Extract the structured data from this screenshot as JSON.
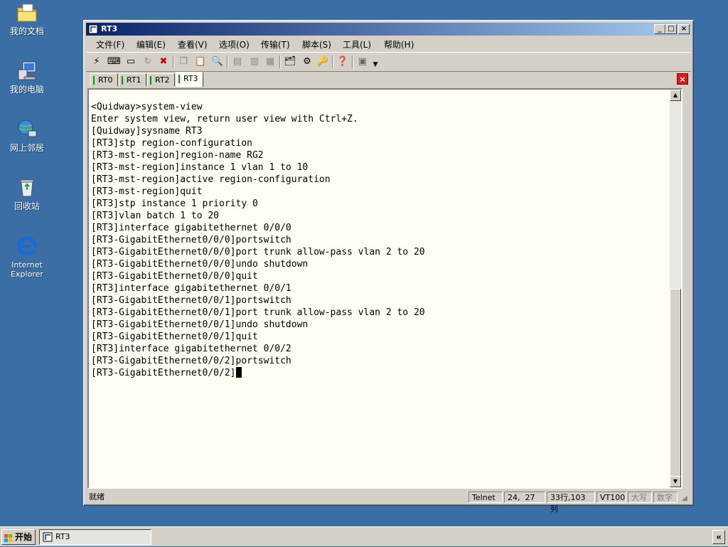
{
  "desktop": {
    "icons": [
      {
        "label": "我的文档"
      },
      {
        "label": "我的电脑"
      },
      {
        "label": "网上邻居"
      },
      {
        "label": "回收站"
      },
      {
        "label": "Internet Explorer"
      }
    ]
  },
  "window": {
    "title": "RT3",
    "controls": {
      "minimize": "_",
      "maximize": "□",
      "close": "×"
    }
  },
  "menu": {
    "items": [
      "文件(F)",
      "编辑(E)",
      "查看(V)",
      "选项(O)",
      "传输(T)",
      "脚本(S)",
      "工具(L)",
      "帮助(H)"
    ]
  },
  "toolbar": {
    "icons": [
      "connect-icon",
      "quick-connect-icon",
      "new-session-icon",
      "reconnect-icon",
      "disconnect-icon",
      "copy-icon",
      "paste-icon",
      "find-icon",
      "print-icon",
      "print-setup-icon",
      "print-screen-icon",
      "session-options-icon",
      "global-options-icon",
      "keymap-icon",
      "help-icon",
      "toolbar-menu-icon"
    ]
  },
  "tabs": {
    "items": [
      "RT0",
      "RT1",
      "RT2",
      "RT3"
    ],
    "active_index": 3,
    "close_label": "×"
  },
  "terminal": {
    "lines": [
      "<Quidway>system-view",
      "Enter system view, return user view with Ctrl+Z.",
      "[Quidway]sysname RT3",
      "[RT3]stp region-configuration",
      "[RT3-mst-region]region-name RG2",
      "[RT3-mst-region]instance 1 vlan 1 to 10",
      "[RT3-mst-region]active region-configuration",
      "[RT3-mst-region]quit",
      "[RT3]stp instance 1 priority 0",
      "[RT3]vlan batch 1 to 20",
      "[RT3]interface gigabitethernet 0/0/0",
      "[RT3-GigabitEthernet0/0/0]portswitch",
      "[RT3-GigabitEthernet0/0/0]port trunk allow-pass vlan 2 to 20",
      "[RT3-GigabitEthernet0/0/0]undo shutdown",
      "[RT3-GigabitEthernet0/0/0]quit",
      "[RT3]interface gigabitethernet 0/0/1",
      "[RT3-GigabitEthernet0/0/1]portswitch",
      "[RT3-GigabitEthernet0/0/1]port trunk allow-pass vlan 2 to 20",
      "[RT3-GigabitEthernet0/0/1]undo shutdown",
      "[RT3-GigabitEthernet0/0/1]quit",
      "[RT3]interface gigabitethernet 0/0/2",
      "[RT3-GigabitEthernet0/0/2]portswitch",
      "[RT3-GigabitEthernet0/0/2]"
    ]
  },
  "status": {
    "ready": "就绪",
    "protocol": "Telnet",
    "position": "24,  27",
    "size": "33行,103列",
    "emulation": "VT100",
    "caps": "大写",
    "num": "数字"
  },
  "taskbar": {
    "start_label": "开始",
    "task_label": "RT3",
    "tray_label": "«"
  },
  "colors": {
    "desktop": "#3a6ea5",
    "title_start": "#0a246a",
    "title_end": "#a6caf0",
    "terminal_bg": "#fffef4",
    "tab_indicator": "#00a000",
    "tab_close": "#d42020"
  }
}
